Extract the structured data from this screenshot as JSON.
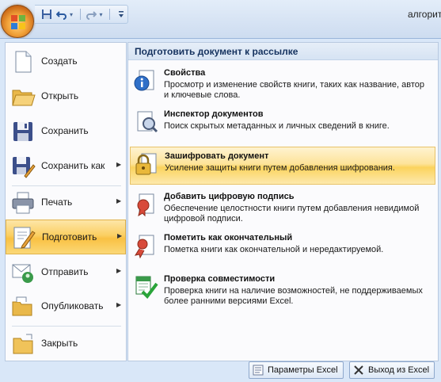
{
  "app": {
    "title": "алгоритм"
  },
  "quick_access": {
    "items": [
      {
        "icon": "save-icon"
      },
      {
        "icon": "undo-icon"
      },
      {
        "icon": "redo-icon"
      },
      {
        "icon": "customize-qat-icon"
      }
    ]
  },
  "left_menu": {
    "items": [
      {
        "label": "Создать",
        "icon": "new-document-icon",
        "submenu": false
      },
      {
        "label": "Открыть",
        "icon": "open-folder-icon",
        "submenu": false
      },
      {
        "label": "Сохранить",
        "icon": "save-icon",
        "submenu": false
      },
      {
        "label": "Сохранить как",
        "icon": "save-as-icon",
        "submenu": true
      },
      {
        "label": "Печать",
        "icon": "print-icon",
        "submenu": true
      },
      {
        "label": "Подготовить",
        "icon": "prepare-icon",
        "submenu": true,
        "active": true
      },
      {
        "label": "Отправить",
        "icon": "send-icon",
        "submenu": true
      },
      {
        "label": "Опубликовать",
        "icon": "publish-icon",
        "submenu": true
      },
      {
        "label": "Закрыть",
        "icon": "close-folder-icon",
        "submenu": false
      }
    ]
  },
  "right_panel": {
    "header": "Подготовить документ к рассылке",
    "items": [
      {
        "title": "Свойства",
        "description": "Просмотр и изменение свойств книги, таких как название, автор и ключевые слова.",
        "icon": "properties-icon"
      },
      {
        "title": "Инспектор документов",
        "description": "Поиск скрытых метаданных и личных сведений в книге.",
        "icon": "inspect-document-icon"
      },
      {
        "title": "Зашифровать документ",
        "description": "Усиление защиты книги путем добавления шифрования.",
        "icon": "encrypt-lock-icon",
        "highlighted": true
      },
      {
        "title": "Добавить цифровую подпись",
        "description": "Обеспечение целостности книги путем добавления невидимой цифровой подписи.",
        "icon": "digital-signature-icon"
      },
      {
        "title": "Пометить как окончательный",
        "description": "Пометка книги как окончательной и нередактируемой.",
        "icon": "mark-final-icon"
      },
      {
        "title": "Проверка совместимости",
        "description": "Проверка книги на наличие возможностей, не поддерживаемых более ранними версиями Excel.",
        "icon": "compatibility-check-icon"
      }
    ]
  },
  "footer": {
    "options_label": "Параметры Excel",
    "exit_label": "Выход из Excel"
  },
  "colors": {
    "accent_active": "#fbcf62",
    "frame": "#d9e7f8",
    "header_text": "#15325f"
  }
}
